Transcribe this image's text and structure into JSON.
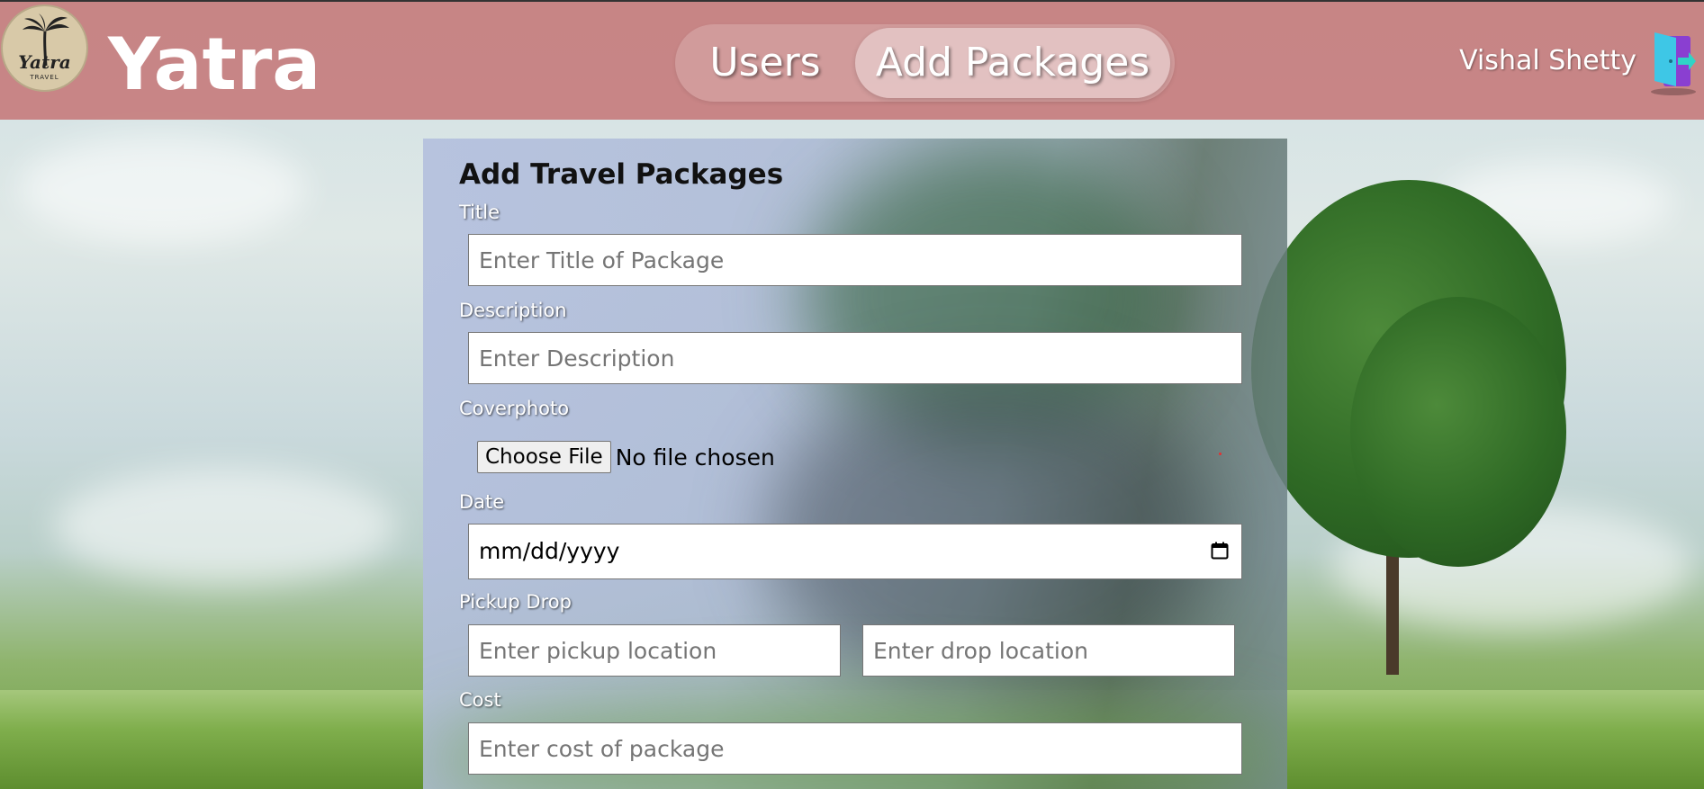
{
  "navbar": {
    "logo_text": "Yatra",
    "logo_sub": "TRAVEL",
    "brand": "Yatra",
    "links": [
      {
        "label": "Users"
      },
      {
        "label": "Add Packages"
      }
    ],
    "username": "Vishal Shetty"
  },
  "form": {
    "title": "Add Travel Packages",
    "title_label": "Title",
    "title_placeholder": "Enter Title of Package",
    "description_label": "Description",
    "description_placeholder": "Enter Description",
    "coverphoto_label": "Coverphoto",
    "file_button": "Choose File",
    "file_status": "No file chosen",
    "date_label": "Date",
    "date_value": "mm/dd/yyyy",
    "pickup_drop_label": "Pickup Drop",
    "pickup_placeholder": "Enter pickup location",
    "drop_placeholder": "Enter drop location",
    "cost_label": "Cost",
    "cost_placeholder": "Enter cost of package"
  },
  "colors": {
    "navbar_bg": "#c47070",
    "logout_cyan": "#3ec7e6",
    "logout_purple": "#8a3fd1"
  },
  "icons": {
    "logo": "palm-tree-logo-icon",
    "logout": "logout-door-icon",
    "date": "calendar-icon"
  }
}
